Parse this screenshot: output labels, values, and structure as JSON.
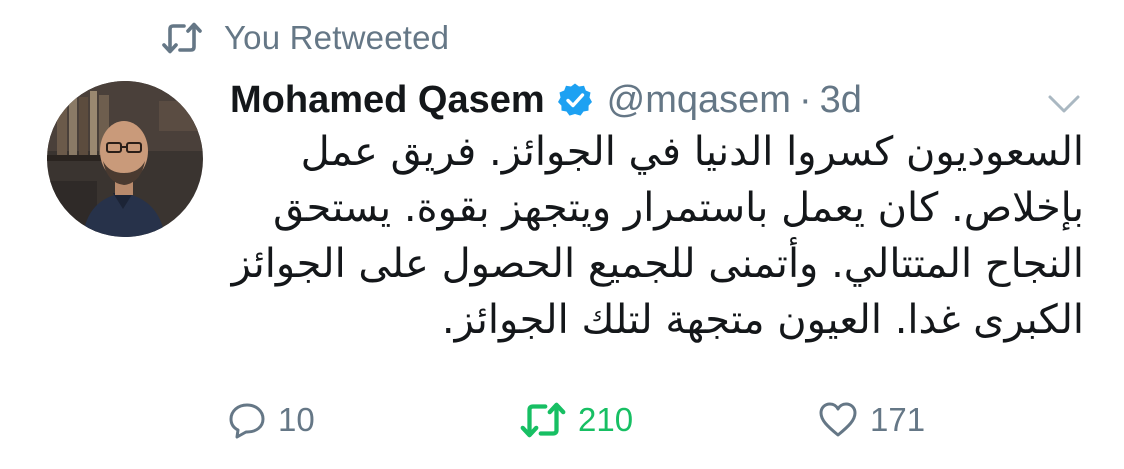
{
  "social_context": {
    "text": "You Retweeted",
    "icon": "retweet-icon"
  },
  "tweet": {
    "author": {
      "name": "Mohamed Qasem",
      "handle": "@mqasem",
      "verified": true,
      "avatar_icon": "avatar"
    },
    "separator": "·",
    "time": "3d",
    "text_lines": [
      "السعوديون كسروا الدنيا في الجوائز. فريق عمل",
      "بإخلاص. كان يعمل باستمرار ويتجهز  بقوة. يستحق",
      "النجاح المتتالي. وأتمنى للجميع الحصول على الجوائز",
      "الكبرى غدا. العيون متجهة لتلك الجوائز."
    ],
    "actions": {
      "reply": {
        "count": "10",
        "icon": "reply-icon"
      },
      "retweet": {
        "count": "210",
        "icon": "retweet-icon",
        "active": true
      },
      "like": {
        "count": "171",
        "icon": "heart-icon"
      }
    }
  },
  "colors": {
    "text_primary": "#14171a",
    "text_secondary": "#657786",
    "verified_blue": "#1da1f2",
    "retweet_green": "#17bf63"
  }
}
